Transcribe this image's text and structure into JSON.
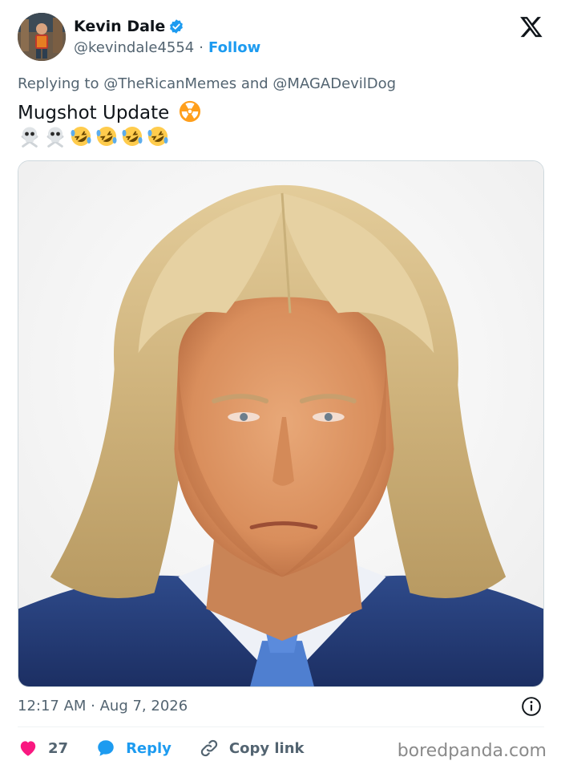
{
  "author": {
    "name": "Kevin Dale",
    "handle": "@kevindale4554",
    "separator": "·",
    "follow_label": "Follow",
    "verified_color": "#1d9bf0"
  },
  "platform_icon": "x-logo-icon",
  "reply_context": "Replying to @TheRicanMemes and @MAGADevilDog",
  "tweet": {
    "text": "Mugshot Update",
    "text_emoji": "radioactive-icon",
    "emoji_line": [
      "skull-crossbones-icon",
      "skull-crossbones-icon",
      "rofl-icon",
      "rofl-icon",
      "rofl-icon",
      "rofl-icon"
    ]
  },
  "media": {
    "type": "image",
    "subject": "portrait-photo"
  },
  "timestamp": "12:17 AM · Aug 7, 2026",
  "actions": {
    "like_count": "27",
    "reply_label": "Reply",
    "copy_label": "Copy link"
  },
  "watermark": "boredpanda.com",
  "colors": {
    "accent": "#1d9bf0",
    "like": "#f91880",
    "text": "#0f1419",
    "muted": "#536471"
  }
}
